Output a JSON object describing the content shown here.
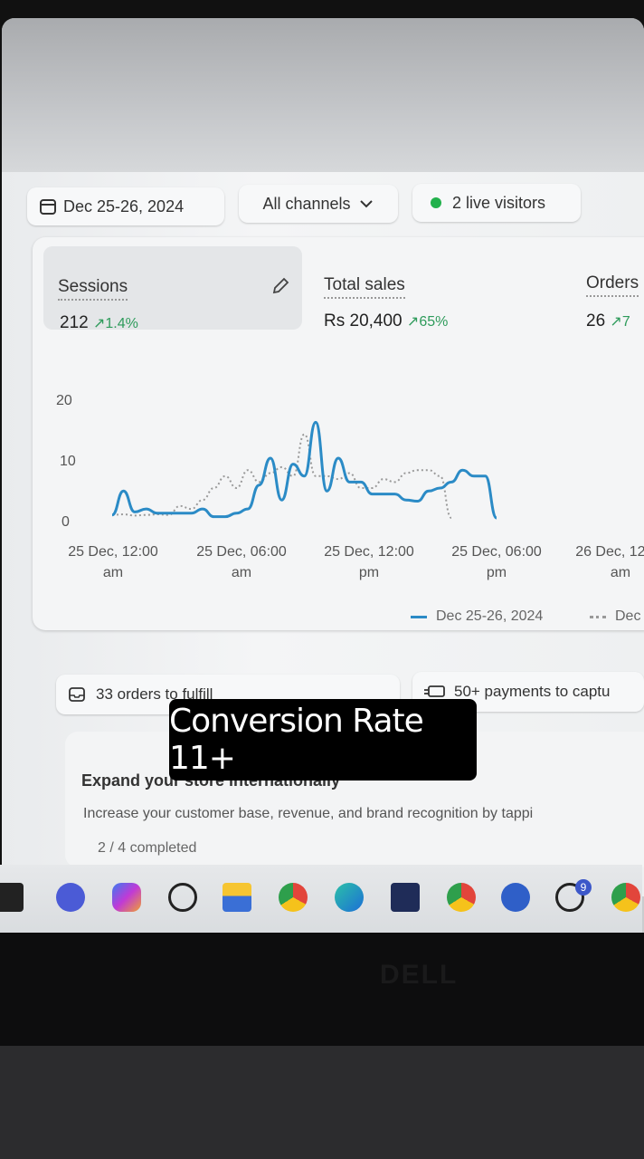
{
  "toolbar": {
    "date_range": "Dec 25-26, 2024",
    "channels": "All channels",
    "live_visitors": "2 live visitors",
    "live_color": "#22b14c"
  },
  "metrics": [
    {
      "label": "Sessions",
      "value": "212",
      "change": "1.4%"
    },
    {
      "label": "Total sales",
      "value": "Rs 20,400",
      "change": "65%"
    },
    {
      "label": "Orders",
      "value": "26",
      "change": "7"
    }
  ],
  "chart_data": {
    "type": "line",
    "title": "",
    "xlabel": "",
    "ylabel": "",
    "ylim": [
      0,
      20
    ],
    "y_ticks": [
      "20",
      "10",
      "0"
    ],
    "x_ticks": [
      {
        "line1": "25 Dec, 12:00",
        "line2": "am"
      },
      {
        "line1": "25 Dec, 06:00",
        "line2": "am"
      },
      {
        "line1": "25 Dec, 12:00",
        "line2": "pm"
      },
      {
        "line1": "25 Dec, 06:00",
        "line2": "pm"
      },
      {
        "line1": "26 Dec, 12:00",
        "line2": "am"
      }
    ],
    "grid": false,
    "legend_position": "bottom-right",
    "series": [
      {
        "name": "Dec 25-26, 2024",
        "color": "#2b8bc6",
        "style": "solid",
        "x": [
          0,
          1,
          2,
          3,
          4,
          5,
          6,
          7,
          8,
          9,
          10,
          11,
          12,
          13,
          14,
          15,
          16,
          17,
          18,
          19,
          20,
          21,
          22,
          23,
          24,
          25,
          26,
          27,
          28,
          29,
          30,
          31,
          32,
          33,
          34,
          35,
          36,
          37,
          38,
          39,
          40,
          41,
          42,
          43,
          44,
          45,
          46,
          47,
          48
        ],
        "y": [
          0.5,
          4.5,
          1,
          1.5,
          0.8,
          0.8,
          0.8,
          0.8,
          1.5,
          0.2,
          0.2,
          0.8,
          1.5,
          5.5,
          10,
          3,
          9,
          7,
          16,
          4.5,
          10,
          6,
          6,
          4,
          4,
          4,
          3,
          2.8,
          4.5,
          5,
          6,
          8,
          7,
          7,
          0,
          0,
          0,
          0,
          0,
          0,
          0,
          0,
          0,
          0,
          0,
          0,
          0,
          0,
          0
        ]
      },
      {
        "name": "Dec",
        "color": "#9a9a9a",
        "style": "dotted",
        "x": [
          0,
          1,
          2,
          3,
          4,
          5,
          6,
          7,
          8,
          9,
          10,
          11,
          12,
          13,
          14,
          15,
          16,
          17,
          18,
          19,
          20,
          21,
          22,
          23,
          24,
          25,
          26,
          27,
          28,
          29,
          30,
          31,
          32,
          33,
          34
        ],
        "y": [
          0.5,
          0.6,
          0.4,
          0.5,
          0.6,
          0.5,
          2,
          1.5,
          3,
          5,
          7,
          5,
          8,
          6,
          7.5,
          8.5,
          7,
          14,
          7,
          7,
          6.5,
          7.5,
          5,
          5,
          6.5,
          6,
          7.5,
          8,
          8,
          7,
          0,
          0,
          0,
          0,
          0
        ]
      }
    ]
  },
  "tasks": [
    {
      "label": "33 orders to fulfill",
      "icon": "inbox-icon"
    },
    {
      "label": "50+ payments to captu",
      "icon": "payment-icon"
    }
  ],
  "expand": {
    "title": "Expand your store internationally",
    "description": "Increase your customer base, revenue, and brand recognition by tappi",
    "progress": "2 / 4 completed"
  },
  "overlay": {
    "caption": "Conversion Rate 11+"
  },
  "taskbar": {
    "icons": [
      "task-view-icon",
      "meet-icon",
      "copilot-icon",
      "whatsapp-icon",
      "file-explorer-icon",
      "chrome-icon",
      "edge-icon",
      "store-icon",
      "chrome-profile-icon",
      "vpn-icon",
      "whatsapp-notify-icon",
      "chrome-extra-icon"
    ],
    "whatsapp_badge": "9"
  },
  "bezel": {
    "brand": "DELL"
  }
}
